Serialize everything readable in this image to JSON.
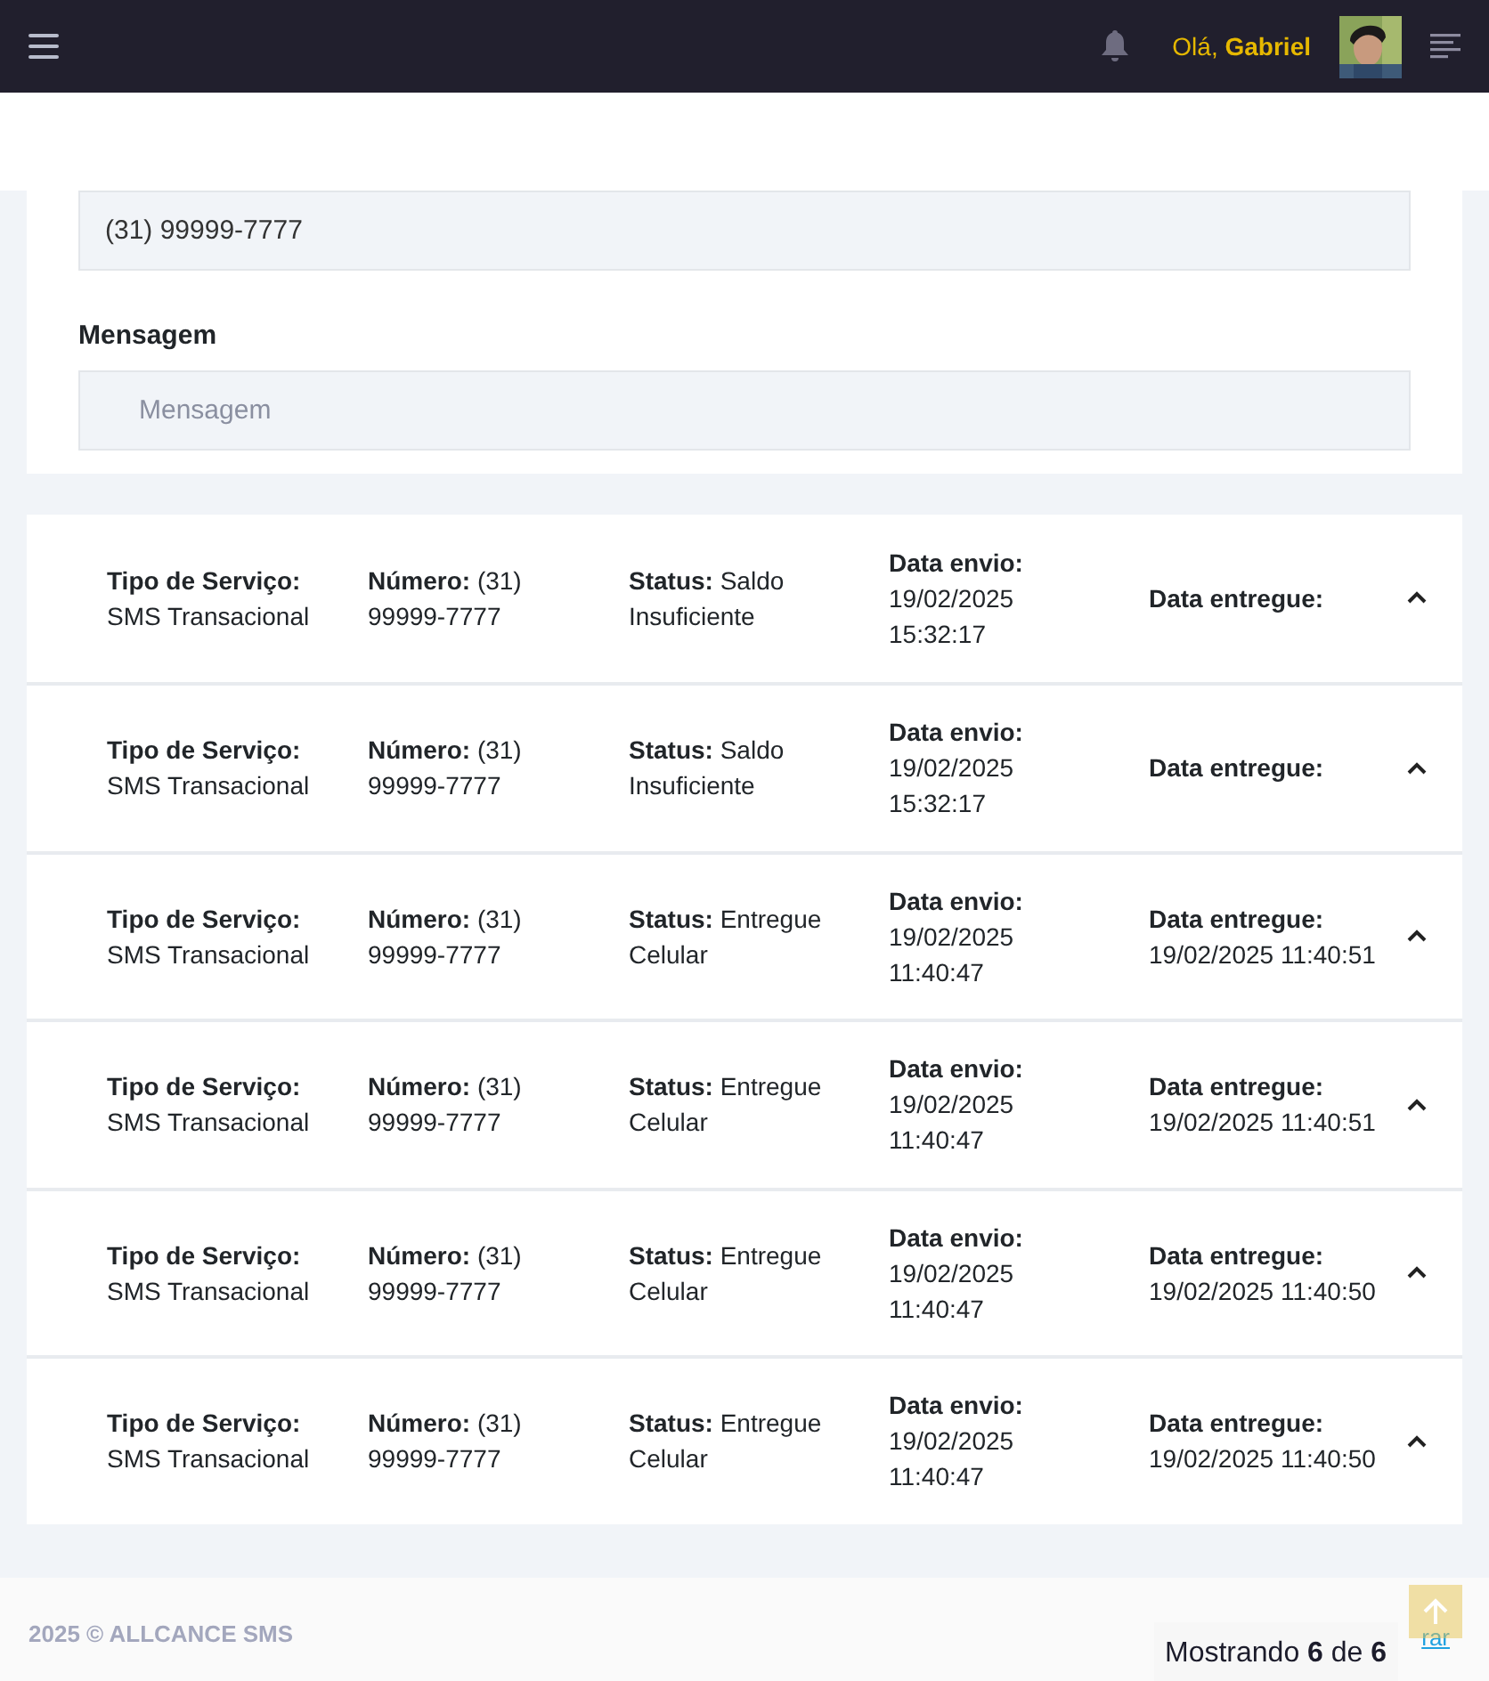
{
  "topbar": {
    "greeting": "Olá,",
    "user_name": "Gabriel"
  },
  "form": {
    "phone": {
      "value": "(31) 99999-7777"
    },
    "message": {
      "label": "Mensagem",
      "placeholder": "Mensagem"
    }
  },
  "messages": [
    {
      "expanded": true,
      "fields": [
        {
          "label": "Tipo de Serviço:",
          "value": "SMS Transacional"
        },
        {
          "label": "Número:",
          "value": "(31) 99999-7777"
        },
        {
          "label": "Status:",
          "value": "Saldo Insuficiente"
        },
        {
          "label": "Data envio:",
          "value": "19/02/2025 15:32:17"
        },
        {
          "label": "Data entregue:"
        }
      ]
    },
    {
      "expanded": true,
      "fields": [
        {
          "label": "Tipo de Serviço:",
          "value": "SMS Transacional"
        },
        {
          "label": "Número:",
          "value": "(31) 99999-7777"
        },
        {
          "label": "Status:",
          "value": "Saldo Insuficiente"
        },
        {
          "label": "Data envio:",
          "value": "19/02/2025 15:32:17"
        },
        {
          "label": "Data entregue:"
        }
      ]
    },
    {
      "expanded": true,
      "fields": [
        {
          "label": "Tipo de Serviço:",
          "value": "SMS Transacional"
        },
        {
          "label": "Número:",
          "value": "(31) 99999-7777"
        },
        {
          "label": "Status:",
          "value": "Entregue Celular"
        },
        {
          "label": "Data envio:",
          "value": "19/02/2025 11:40:47"
        },
        {
          "label": "Data entregue:",
          "value": "19/02/2025 11:40:51"
        }
      ]
    },
    {
      "expanded": true,
      "fields": [
        {
          "label": "Tipo de Serviço:",
          "value": "SMS Transacional"
        },
        {
          "label": "Número:",
          "value": "(31) 99999-7777"
        },
        {
          "label": "Status:",
          "value": "Entregue Celular"
        },
        {
          "label": "Data envio:",
          "value": "19/02/2025 11:40:47"
        },
        {
          "label": "Data entregue:",
          "value": "19/02/2025 11:40:51"
        }
      ]
    },
    {
      "expanded": true,
      "fields": [
        {
          "label": "Tipo de Serviço:",
          "value": "SMS Transacional"
        },
        {
          "label": "Número:",
          "value": "(31) 99999-7777"
        },
        {
          "label": "Status:",
          "value": "Entregue Celular"
        },
        {
          "label": "Data envio:",
          "value": "19/02/2025 11:40:47"
        },
        {
          "label": "Data entregue:",
          "value": "19/02/2025 11:40:50"
        }
      ]
    },
    {
      "expanded": true,
      "fields": [
        {
          "label": "Tipo de Serviço:",
          "value": "SMS Transacional"
        },
        {
          "label": "Número:",
          "value": "(31) 99999-7777"
        },
        {
          "label": "Status:",
          "value": "Entregue Celular"
        },
        {
          "label": "Data envio:",
          "value": "19/02/2025 11:40:47"
        },
        {
          "label": "Data entregue:",
          "value": "19/02/2025 11:40:50"
        }
      ]
    }
  ],
  "footer": {
    "copyright": "2025 © ALLCANCE SMS",
    "link_fragment": "rar",
    "pagination_info": "Mostrando **6** de **6**"
  }
}
